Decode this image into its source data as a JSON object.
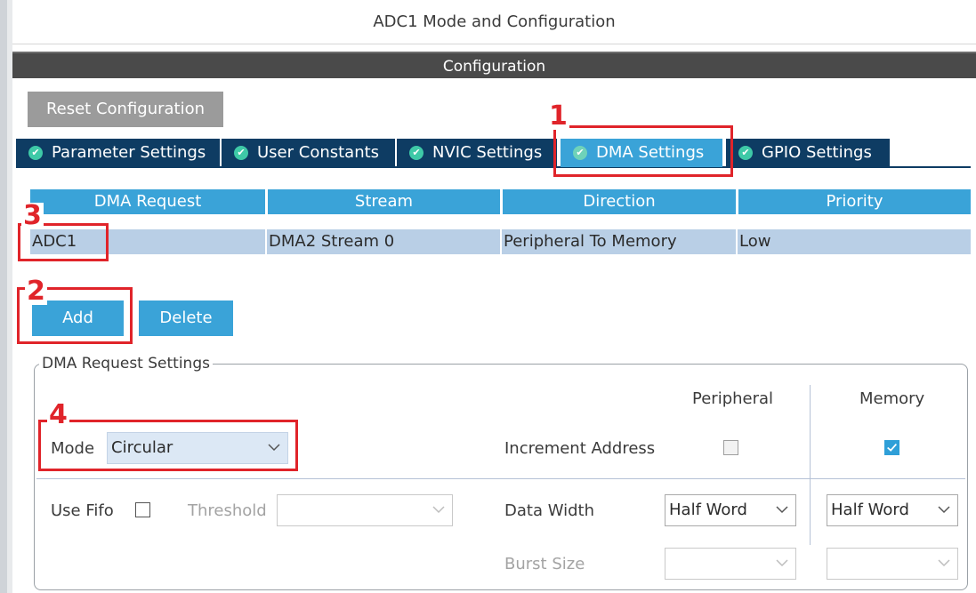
{
  "window": {
    "title": "ADC1 Mode and Configuration"
  },
  "section": {
    "title": "Configuration"
  },
  "toolbar": {
    "reset_label": "Reset Configuration"
  },
  "tabs": [
    {
      "label": "Parameter Settings",
      "active": false
    },
    {
      "label": "User Constants",
      "active": false
    },
    {
      "label": "NVIC Settings",
      "active": false
    },
    {
      "label": "DMA Settings",
      "active": true
    },
    {
      "label": "GPIO Settings",
      "active": false
    }
  ],
  "table": {
    "columns": [
      "DMA Request",
      "Stream",
      "Direction",
      "Priority"
    ],
    "rows": [
      [
        "ADC1",
        "DMA2 Stream 0",
        "Peripheral To Memory",
        "Low"
      ]
    ]
  },
  "actions": {
    "add_label": "Add",
    "delete_label": "Delete"
  },
  "dma_settings": {
    "legend": "DMA Request Settings",
    "peripheral_header": "Peripheral",
    "memory_header": "Memory",
    "mode_label": "Mode",
    "mode_value": "Circular",
    "increment_label": "Increment Address",
    "increment_peripheral": false,
    "increment_memory": true,
    "use_fifo_label": "Use Fifo",
    "use_fifo": false,
    "threshold_label": "Threshold",
    "threshold_value": "",
    "data_width_label": "Data Width",
    "data_width_peripheral": "Half Word",
    "data_width_memory": "Half Word",
    "burst_label": "Burst Size",
    "burst_peripheral": "",
    "burst_memory": ""
  },
  "annotations": [
    "1",
    "2",
    "3",
    "4"
  ],
  "colors": {
    "accent": "#3aa3d8",
    "tab_dark": "#0e3c63",
    "highlight_row": "#b9cfe6",
    "annotation_red": "#e0242a",
    "header_bar": "#4a4a4a"
  }
}
